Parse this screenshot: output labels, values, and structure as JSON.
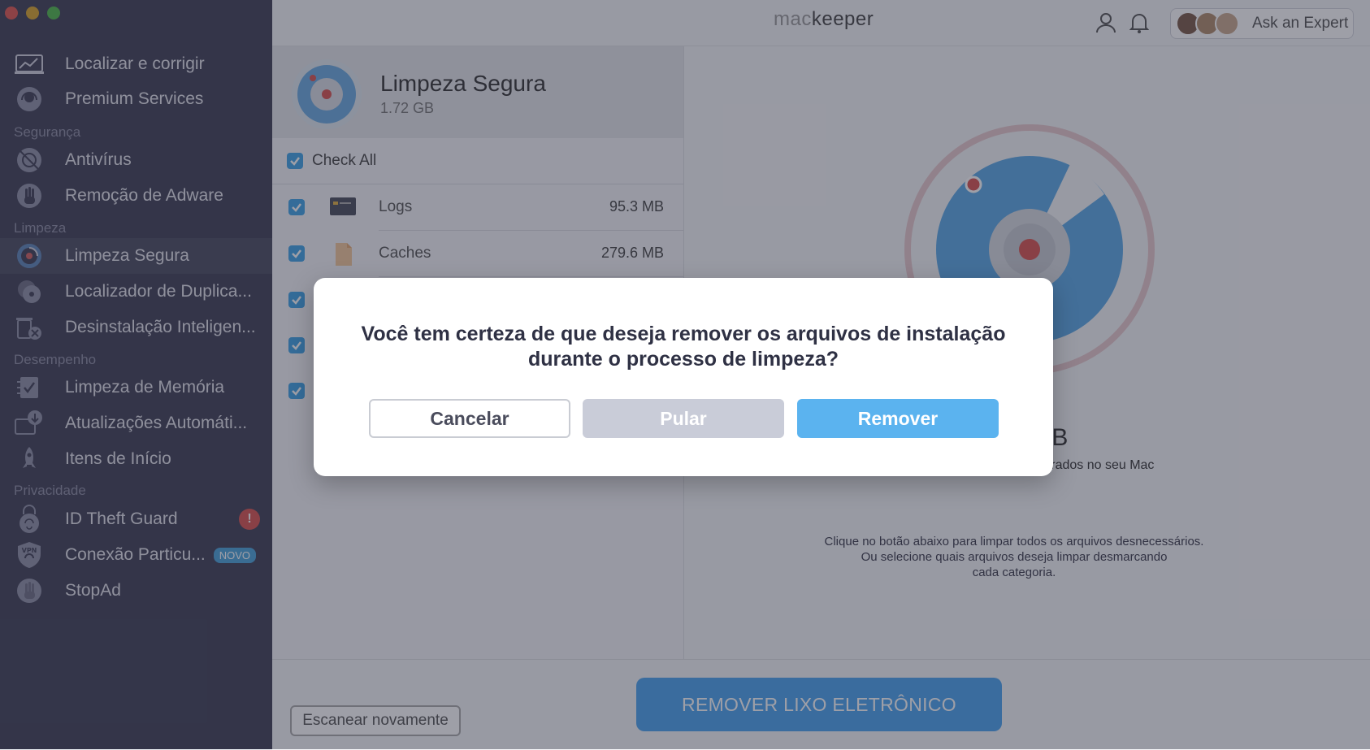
{
  "sidebar": {
    "items": [
      {
        "label": "Localizar e corrigir"
      },
      {
        "label": "Premium Services"
      },
      {
        "label": "Antivírus"
      },
      {
        "label": "Remoção de Adware"
      },
      {
        "label": "Limpeza Segura"
      },
      {
        "label": "Localizador de Duplica..."
      },
      {
        "label": "Desinstalação Inteligen..."
      },
      {
        "label": "Limpeza de Memória"
      },
      {
        "label": "Atualizações Automáti..."
      },
      {
        "label": "Itens de Início"
      },
      {
        "label": "ID Theft Guard",
        "badge": "!"
      },
      {
        "label": "Conexão Particu...",
        "badge": "NOVO"
      },
      {
        "label": "StopAd"
      }
    ],
    "sections": [
      "Segurança",
      "Limpeza",
      "Desempenho",
      "Privacidade"
    ]
  },
  "header": {
    "logo_prefix": "mac",
    "logo_suffix": "keeper",
    "expert_label": "Ask an Expert"
  },
  "panel": {
    "title": "Limpeza Segura",
    "size": "1.72 GB",
    "check_all": "Check All",
    "rows": [
      {
        "name": "Logs",
        "size": "95.3 MB"
      },
      {
        "name": "Caches",
        "size": "279.6 MB"
      }
    ]
  },
  "summary": {
    "size_partial": "GB",
    "found_partial": "ontrados no seu Mac",
    "help_line1": "Clique no botão abaixo para limpar todos os arquivos desnecessários.",
    "help_line2": "Ou selecione quais arquivos deseja limpar desmarcando",
    "help_line3": "cada categoria."
  },
  "bottom": {
    "rescan": "Escanear novamente",
    "remove_junk": "REMOVER LIXO ELETRÔNICO"
  },
  "dialog": {
    "message": "Você tem certeza de que deseja remover os arquivos de instalação durante o processo de limpeza?",
    "cancel": "Cancelar",
    "skip": "Pular",
    "remove": "Remover"
  },
  "colors": {
    "accent": "#5bb3ef",
    "sidebar_bg": "#3e3f55",
    "warn": "#d9534f"
  }
}
